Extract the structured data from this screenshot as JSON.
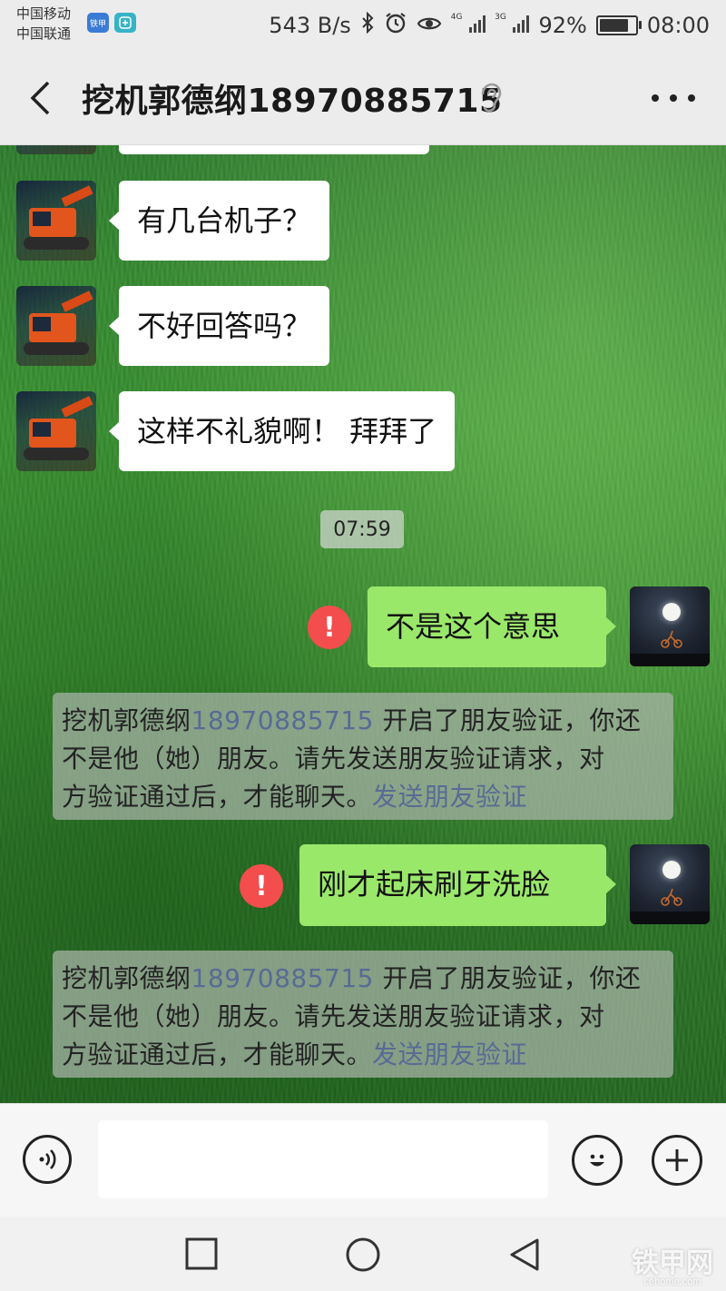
{
  "status_bar": {
    "carrier_1": "中国移动",
    "carrier_2": "中国联通",
    "app_icon_1": "铁甲",
    "speed": "543 B/s",
    "net_1": "4G",
    "net_2": "3G",
    "battery": "92%",
    "battery_level": 0.92,
    "time": "08:00"
  },
  "header": {
    "title": "挖机郭德纲18970885715",
    "back_icon": "chevron-left-icon",
    "mode_icon": "ear-icon",
    "more_icon": "more-dots-icon"
  },
  "messages": {
    "in_1": "有几台机子？",
    "in_2": "不好回答吗？",
    "in_3": "这样不礼貌啊！ 拜拜了",
    "timestamp": "07:59",
    "out_1": "不是这个意思",
    "out_2": "刚才起床刷牙洗脸",
    "fail_mark": "!"
  },
  "system_notice": {
    "name": "挖机郭德纲",
    "number": "18970885715",
    "text_1": "开启了朋友验证，你还",
    "text_2": "不是他（她）朋友。请先发送朋友验证请求，对",
    "text_3": "方验证通过后，才能聊天。",
    "link": "发送朋友验证"
  },
  "input_bar": {
    "voice_icon": "voice-icon",
    "emoji_icon": "emoji-icon",
    "plus_icon": "plus-icon",
    "input_value": ""
  },
  "nav_bar": {
    "recent_icon": "square-icon",
    "home_icon": "circle-icon",
    "back_icon": "triangle-back-icon"
  },
  "watermark": {
    "main": "铁甲网",
    "sub": "cehome.com"
  },
  "colors": {
    "outgoing_bubble": "#9ae86a",
    "incoming_bubble": "#ffffff",
    "fail_red": "#f34d4d",
    "link_blue": "#576b95"
  }
}
